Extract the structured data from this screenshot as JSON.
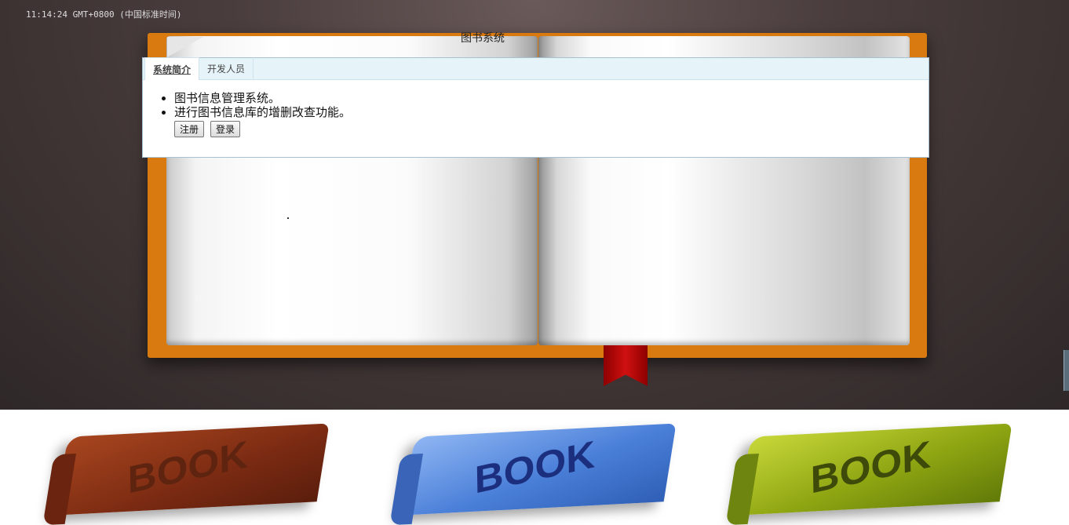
{
  "clock": {
    "text": "11:14:24 GMT+0800 (中国标准时间)"
  },
  "app": {
    "title": "图书系统"
  },
  "tabs": [
    {
      "label": "系统简介",
      "active": true
    },
    {
      "label": "开发人员",
      "active": false
    }
  ],
  "intro": {
    "items": [
      "图书信息管理系统。",
      "进行图书信息库的增删改查功能。"
    ],
    "register_label": "注册",
    "login_label": "登录"
  },
  "decor": {
    "bottom_books": [
      {
        "label": "BOOK",
        "color": "#8a3418"
      },
      {
        "label": "BOOK",
        "color": "#4a7fd8"
      },
      {
        "label": "BOOK",
        "color": "#8ea512"
      }
    ]
  }
}
